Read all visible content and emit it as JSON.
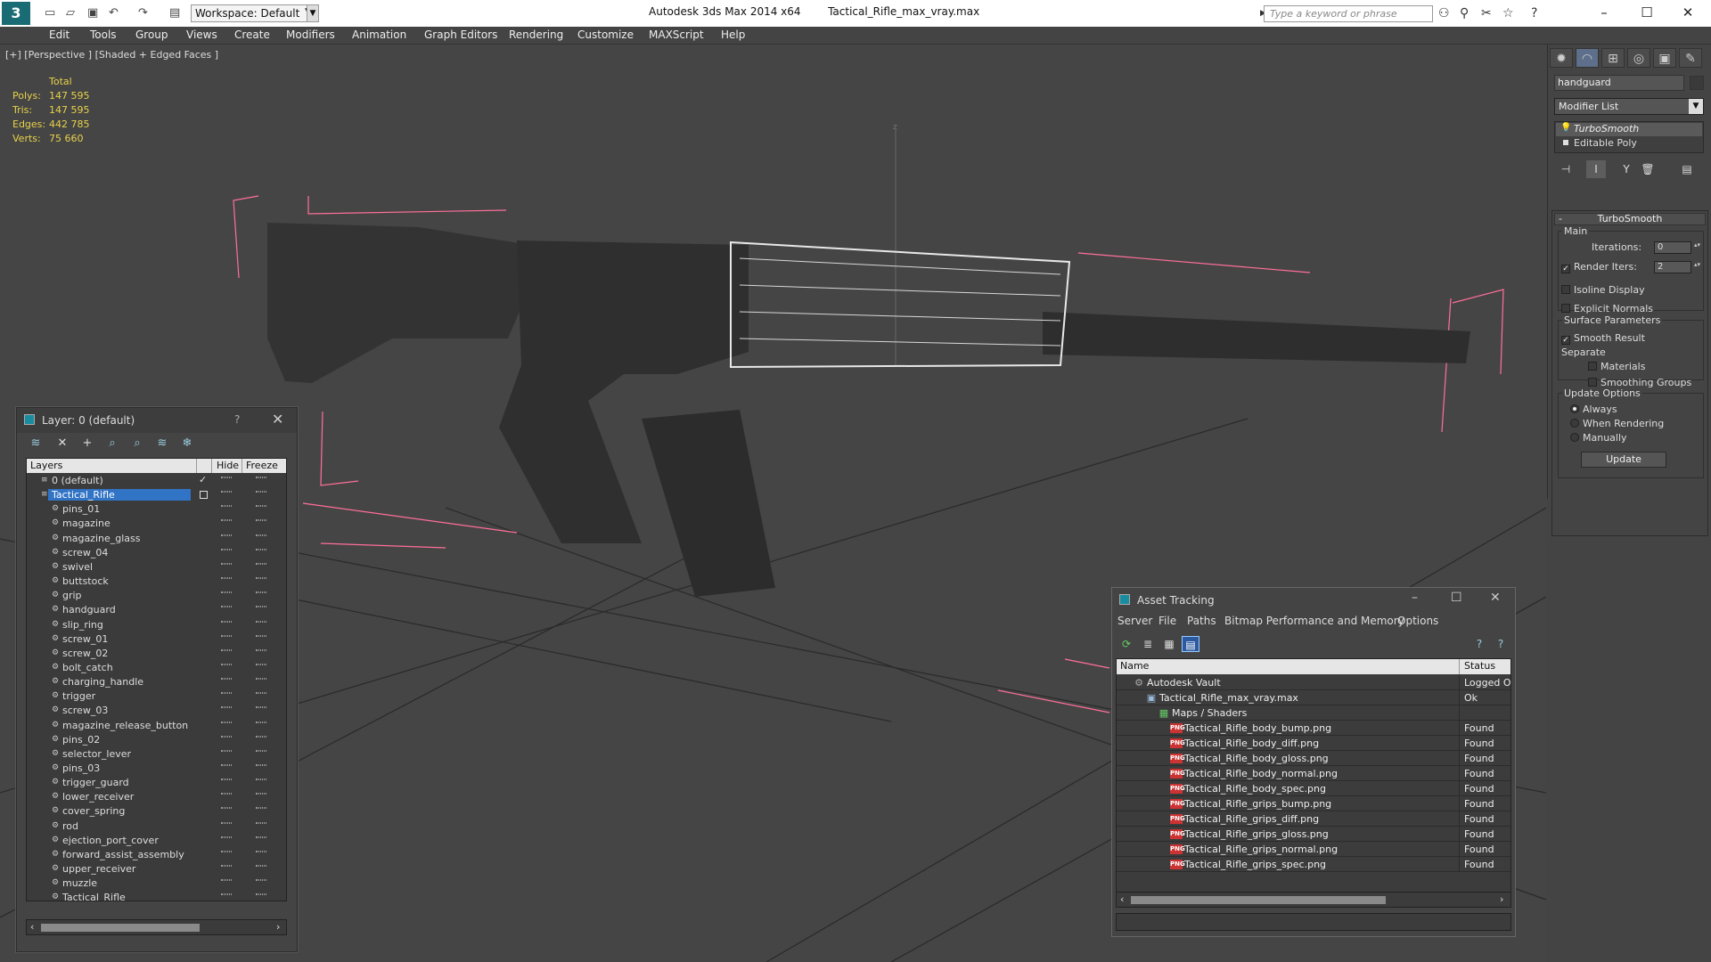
{
  "titlebar": {
    "app_title": "Autodesk 3ds Max  2014 x64",
    "file_title": "Tactical_Rifle_max_vray.max",
    "workspace": "Workspace: Default",
    "search_placeholder": "Type a keyword or phrase",
    "logo_glyph": "3",
    "window_controls": {
      "minimize": "–",
      "maximize": "☐",
      "close": "✕"
    }
  },
  "menu": [
    "Edit",
    "Tools",
    "Group",
    "Views",
    "Create",
    "Modifiers",
    "Animation",
    "Graph Editors",
    "Rendering",
    "Customize",
    "MAXScript",
    "Help"
  ],
  "viewport": {
    "label": "[+] [Perspective ] [Shaded + Edged Faces ]",
    "stats": {
      "header": "Total",
      "rows": [
        {
          "label": "Polys:",
          "value": "147 595"
        },
        {
          "label": "Tris:",
          "value": "147 595"
        },
        {
          "label": "Edges:",
          "value": "442 785"
        },
        {
          "label": "Verts:",
          "value": "75 660"
        }
      ]
    },
    "axis_label": "z"
  },
  "command_panel": {
    "object_name": "handguard",
    "modifier_list": "Modifier List",
    "stack": {
      "top": "TurboSmooth",
      "base": "Editable Poly"
    },
    "rollout_title": "TurboSmooth",
    "main_group": "Main",
    "iterations_label": "Iterations:",
    "iterations_value": "0",
    "render_iters_label": "Render Iters:",
    "render_iters_value": "2",
    "isoline_label": "Isoline Display",
    "explicit_normals_label": "Explicit Normals",
    "surface_group": "Surface Parameters",
    "smooth_result_label": "Smooth Result",
    "separate_label": "Separate",
    "materials_label": "Materials",
    "smoothing_groups_label": "Smoothing Groups",
    "update_group": "Update Options",
    "always_label": "Always",
    "when_rendering_label": "When Rendering",
    "manually_label": "Manually",
    "update_button": "Update",
    "render_iters_checked": true,
    "smooth_result_checked": true,
    "update_option_selected": "Always"
  },
  "layer_window": {
    "title": "Layer: 0 (default)",
    "help": "?",
    "columns": {
      "layers": "Layers",
      "hide": "Hide",
      "freeze": "Freeze"
    },
    "rows": [
      {
        "name": "0 (default)",
        "type": "layer"
      },
      {
        "name": "Tactical_Rifle",
        "type": "layer",
        "selected": true
      },
      {
        "name": "pins_01",
        "type": "object"
      },
      {
        "name": "magazine",
        "type": "object"
      },
      {
        "name": "magazine_glass",
        "type": "object"
      },
      {
        "name": "screw_04",
        "type": "object"
      },
      {
        "name": "swivel",
        "type": "object"
      },
      {
        "name": "buttstock",
        "type": "object"
      },
      {
        "name": "grip",
        "type": "object"
      },
      {
        "name": "handguard",
        "type": "object"
      },
      {
        "name": "slip_ring",
        "type": "object"
      },
      {
        "name": "screw_01",
        "type": "object"
      },
      {
        "name": "screw_02",
        "type": "object"
      },
      {
        "name": "bolt_catch",
        "type": "object"
      },
      {
        "name": "charging_handle",
        "type": "object"
      },
      {
        "name": "trigger",
        "type": "object"
      },
      {
        "name": "screw_03",
        "type": "object"
      },
      {
        "name": "magazine_release_button",
        "type": "object"
      },
      {
        "name": "pins_02",
        "type": "object"
      },
      {
        "name": "selector_lever",
        "type": "object"
      },
      {
        "name": "pins_03",
        "type": "object"
      },
      {
        "name": "trigger_guard",
        "type": "object"
      },
      {
        "name": "lower_receiver",
        "type": "object"
      },
      {
        "name": "cover_spring",
        "type": "object"
      },
      {
        "name": "rod",
        "type": "object"
      },
      {
        "name": "ejection_port_cover",
        "type": "object"
      },
      {
        "name": "forward_assist_assembly",
        "type": "object"
      },
      {
        "name": "upper_receiver",
        "type": "object"
      },
      {
        "name": "muzzle",
        "type": "object"
      },
      {
        "name": "Tactical_Rifle",
        "type": "object"
      }
    ]
  },
  "asset_tracking": {
    "title": "Asset Tracking",
    "menu": [
      "Server",
      "File",
      "Paths",
      "Bitmap Performance and Memory",
      "Options"
    ],
    "columns": {
      "name": "Name",
      "status": "Status"
    },
    "rows": [
      {
        "name": "Autodesk Vault",
        "status": "Logged Ou",
        "indent": 0,
        "icon": "vault"
      },
      {
        "name": "Tactical_Rifle_max_vray.max",
        "status": "Ok",
        "indent": 1,
        "icon": "max"
      },
      {
        "name": "Maps / Shaders",
        "status": "",
        "indent": 2,
        "icon": "maps"
      },
      {
        "name": "Tactical_Rifle_body_bump.png",
        "status": "Found",
        "indent": 3,
        "icon": "png"
      },
      {
        "name": "Tactical_Rifle_body_diff.png",
        "status": "Found",
        "indent": 3,
        "icon": "png"
      },
      {
        "name": "Tactical_Rifle_body_gloss.png",
        "status": "Found",
        "indent": 3,
        "icon": "png"
      },
      {
        "name": "Tactical_Rifle_body_normal.png",
        "status": "Found",
        "indent": 3,
        "icon": "png"
      },
      {
        "name": "Tactical_Rifle_body_spec.png",
        "status": "Found",
        "indent": 3,
        "icon": "png"
      },
      {
        "name": "Tactical_Rifle_grips_bump.png",
        "status": "Found",
        "indent": 3,
        "icon": "png"
      },
      {
        "name": "Tactical_Rifle_grips_diff.png",
        "status": "Found",
        "indent": 3,
        "icon": "png"
      },
      {
        "name": "Tactical_Rifle_grips_gloss.png",
        "status": "Found",
        "indent": 3,
        "icon": "png"
      },
      {
        "name": "Tactical_Rifle_grips_normal.png",
        "status": "Found",
        "indent": 3,
        "icon": "png"
      },
      {
        "name": "Tactical_Rifle_grips_spec.png",
        "status": "Found",
        "indent": 3,
        "icon": "png"
      }
    ],
    "png_badge": "PNG"
  },
  "colors": {
    "accent": "#3173c4",
    "stats": "#e8d24a",
    "bbox": "#ff6f9a",
    "viewport_bg": "#454545"
  }
}
